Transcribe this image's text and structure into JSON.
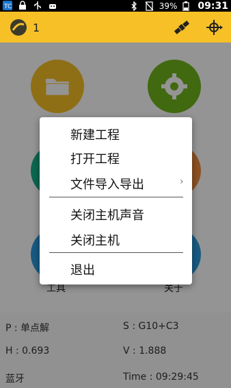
{
  "status_bar": {
    "battery": "39%",
    "time": "09:31"
  },
  "toolbar": {
    "number": "1"
  },
  "tiles": {
    "tools_label": "工具",
    "about_label": "关于"
  },
  "info": {
    "position": "P : 单点解",
    "satellites": "S : G10+C3",
    "h_value": "H : 0.693",
    "v_value": "V : 1.888",
    "connection": "蓝牙",
    "time": "Time :  09:29:45"
  },
  "menu": {
    "new_project": "新建工程",
    "open_project": "打开工程",
    "import_export": "文件导入导出",
    "mute_host": "关闭主机声音",
    "close_host": "关闭主机",
    "exit": "退出"
  },
  "colors": {
    "toolbar": "#f6c026",
    "folder_tile": "#f6c026",
    "settings_tile": "#71b51d",
    "teal_tile": "#16b08c",
    "orange_tile": "#f08c3c",
    "blue_tile": "#2a9be0"
  }
}
